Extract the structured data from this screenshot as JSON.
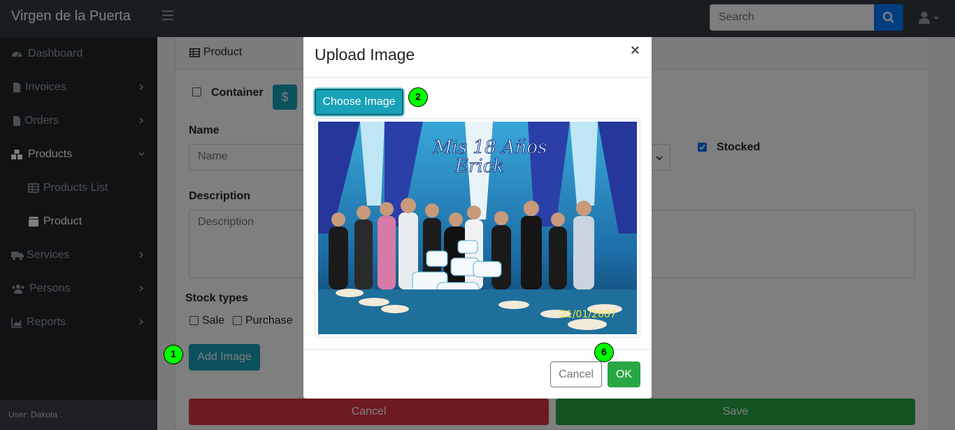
{
  "navbar": {
    "brand": "Virgen de la Puerta",
    "search_placeholder": "Search"
  },
  "sidebar": {
    "items": [
      {
        "label": "Dashboard",
        "icon": "dashboard-icon"
      },
      {
        "label": "Invoices",
        "icon": "file-icon"
      },
      {
        "label": "Orders",
        "icon": "file-icon"
      },
      {
        "label": "Products",
        "icon": "cubes-icon"
      },
      {
        "label": "Products List",
        "icon": "table-icon"
      },
      {
        "label": "Product",
        "icon": "box-icon"
      },
      {
        "label": "Services",
        "icon": "truck-icon"
      },
      {
        "label": "Persons",
        "icon": "users-icon"
      },
      {
        "label": "Reports",
        "icon": "chart-icon"
      }
    ],
    "footer": "User: Dakota ."
  },
  "form": {
    "header": "Product",
    "container_label": "Container",
    "dollar": "$",
    "name_label": "Name",
    "name_placeholder": "Name",
    "stocked_label": "Stocked",
    "description_label": "Description",
    "description_placeholder": "Description",
    "stock_types_label": "Stock types",
    "stock_types": [
      "Sale",
      "Purchase"
    ],
    "add_image": "Add Image",
    "cancel": "Cancel",
    "save": "Save"
  },
  "modal": {
    "title": "Upload Image",
    "close": "×",
    "choose_image": "Choose Image",
    "photo_text_1": "Mis 18 Años",
    "photo_text_2": "Erick",
    "photo_date": "21/01/2007",
    "cancel": "Cancel",
    "ok": "OK"
  },
  "markers": [
    "1",
    "2",
    "6"
  ],
  "colors": {
    "navbar": "#343a40",
    "sidebar": "#212529",
    "primary": "#007bff",
    "info": "#17a2b8",
    "success": "#28a745",
    "danger": "#dc3545",
    "marker": "#00ff00"
  }
}
